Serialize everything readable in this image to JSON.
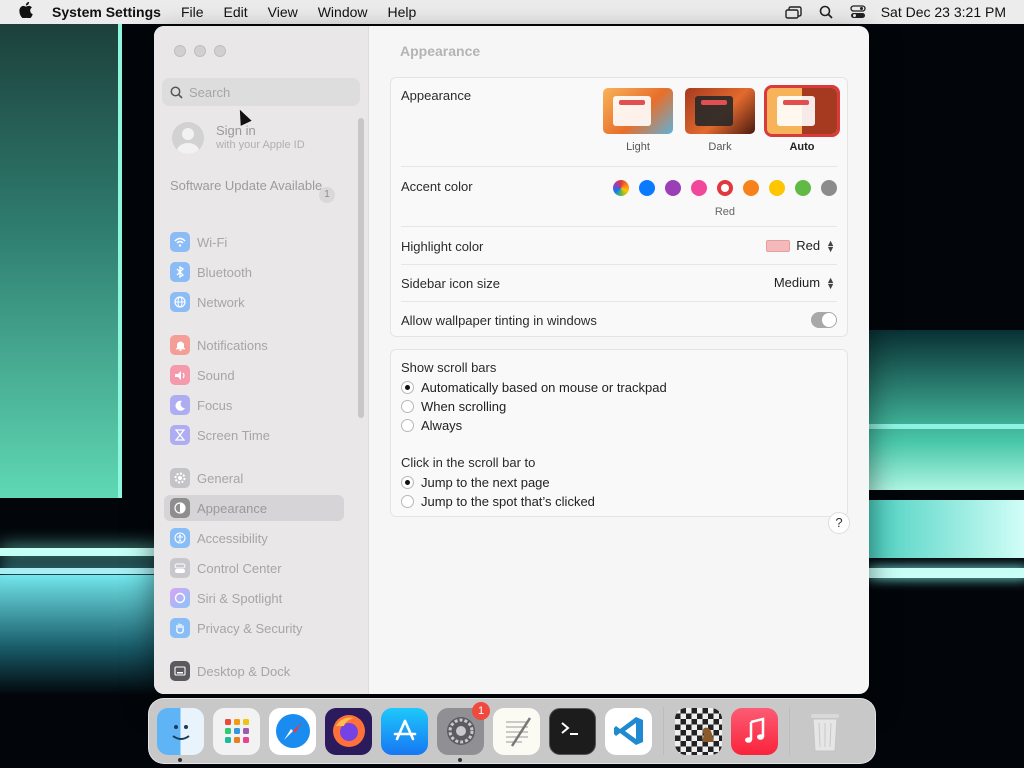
{
  "menubar": {
    "app_name": "System Settings",
    "menus": [
      "File",
      "Edit",
      "View",
      "Window",
      "Help"
    ],
    "datetime": "Sat Dec 23  3:21 PM"
  },
  "sidebar": {
    "search_placeholder": "Search",
    "signin_title": "Sign in",
    "signin_subtitle": "with your Apple ID",
    "software_update": "Software Update Available",
    "software_update_count": "1",
    "items": [
      {
        "label": "Wi-Fi",
        "icon": "wifi-icon",
        "color": "#3b99fc"
      },
      {
        "label": "Bluetooth",
        "icon": "bluetooth-icon",
        "color": "#3b99fc"
      },
      {
        "label": "Network",
        "icon": "globe-icon",
        "color": "#3b99fc"
      },
      {
        "label": "Notifications",
        "icon": "bell-icon",
        "color": "#ff3b30"
      },
      {
        "label": "Sound",
        "icon": "speaker-icon",
        "color": "#ff2d55"
      },
      {
        "label": "Focus",
        "icon": "moon-icon",
        "color": "#5e5ce6"
      },
      {
        "label": "Screen Time",
        "icon": "hourglass-icon",
        "color": "#5e5ce6"
      },
      {
        "label": "General",
        "icon": "gear-icon",
        "color": "#8e8e93"
      },
      {
        "label": "Appearance",
        "icon": "appearance-icon",
        "color": "#1c1c1e"
      },
      {
        "label": "Accessibility",
        "icon": "accessibility-icon",
        "color": "#0a84ff"
      },
      {
        "label": "Control Center",
        "icon": "control-center-icon",
        "color": "#8e8e93"
      },
      {
        "label": "Siri & Spotlight",
        "icon": "siri-icon",
        "color": "#bf5af2"
      },
      {
        "label": "Privacy & Security",
        "icon": "hand-icon",
        "color": "#0a84ff"
      },
      {
        "label": "Desktop & Dock",
        "icon": "dock-icon",
        "color": "#1c1c1e"
      }
    ]
  },
  "content": {
    "title": "Appearance",
    "appearance": {
      "label": "Appearance",
      "options": [
        "Light",
        "Dark",
        "Auto"
      ],
      "selected": "Auto"
    },
    "accent": {
      "label": "Accent color",
      "colors": [
        "multicolor",
        "#0a7aff",
        "#9a3fb5",
        "#f2489b",
        "#e0383e",
        "#f7821b",
        "#ffc600",
        "#62ba46",
        "#8c8c8c"
      ],
      "selected_name": "Red"
    },
    "highlight": {
      "label": "Highlight color",
      "value": "Red",
      "swatch": "#f5b9b9"
    },
    "sidebar_icon_size": {
      "label": "Sidebar icon size",
      "value": "Medium"
    },
    "wallpaper_tinting": {
      "label": "Allow wallpaper tinting in windows",
      "on": false
    },
    "scroll_bars": {
      "label": "Show scroll bars",
      "options": [
        "Automatically based on mouse or trackpad",
        "When scrolling",
        "Always"
      ],
      "selected": 0
    },
    "click_scroll": {
      "label": "Click in the scroll bar to",
      "options": [
        "Jump to the next page",
        "Jump to the spot that’s clicked"
      ],
      "selected": 0
    },
    "help": "?"
  },
  "dock": {
    "apps": [
      "Finder",
      "Launchpad",
      "Safari",
      "Firefox",
      "App Store",
      "System Settings",
      "TextEdit",
      "Terminal",
      "Visual Studio Code",
      "Chess",
      "Music",
      "Trash"
    ],
    "system_settings_badge": "1"
  }
}
